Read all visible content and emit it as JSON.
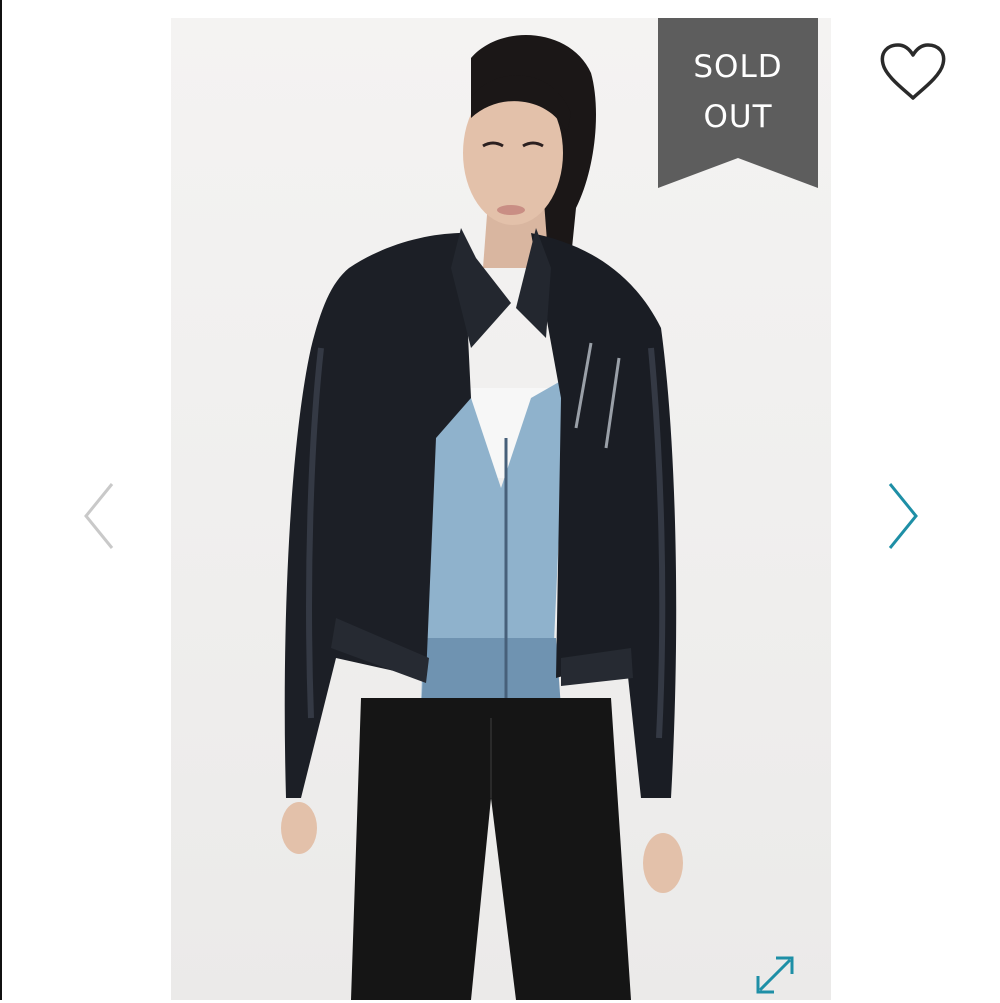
{
  "product_image": {
    "alt": "",
    "status_badge": {
      "line1": "SOLD",
      "line2": "OUT",
      "color": "#5d5d5d"
    }
  },
  "controls": {
    "like_icon": "heart-outline-icon",
    "prev_icon": "chevron-left-icon",
    "next_icon": "chevron-right-icon",
    "expand_icon": "expand-arrows-icon",
    "accent_color": "#1e8fa6",
    "muted_color": "#c9c9c9"
  }
}
